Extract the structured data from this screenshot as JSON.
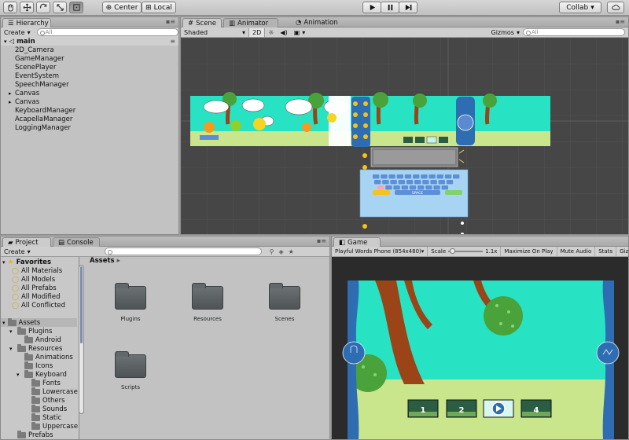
{
  "toolbar": {
    "tools": [
      "hand-icon",
      "move-icon",
      "rotate-icon",
      "scale-icon",
      "rect-icon"
    ],
    "pivot_center": "Center",
    "pivot_local": "Local",
    "collab_label": "Collab",
    "collab_arrow": "▾"
  },
  "hierarchy": {
    "tab_label": "Hierarchy",
    "create_label": "Create",
    "search_placeholder": "All",
    "scene_name": "main",
    "items": [
      {
        "label": "2D_Camera",
        "arrow": ""
      },
      {
        "label": "GameManager",
        "arrow": ""
      },
      {
        "label": "ScenePlayer",
        "arrow": ""
      },
      {
        "label": "EventSystem",
        "arrow": ""
      },
      {
        "label": "SpeechManager",
        "arrow": ""
      },
      {
        "label": "Canvas",
        "arrow": "▸"
      },
      {
        "label": "Canvas",
        "arrow": "▸"
      },
      {
        "label": "KeyboardManager",
        "arrow": ""
      },
      {
        "label": "AcapellaManager",
        "arrow": ""
      },
      {
        "label": "LoggingManager",
        "arrow": ""
      }
    ]
  },
  "scene": {
    "tabs": [
      "Scene",
      "Animator",
      "Animation"
    ],
    "shading": "Shaded",
    "mode_2d": "2D",
    "gizmos_label": "Gizmos",
    "search_placeholder": "All",
    "keyboard_space": "SPACE"
  },
  "project": {
    "tabs": [
      "Project",
      "Console"
    ],
    "create_label": "Create",
    "breadcrumb": "Assets",
    "favorites_label": "Favorites",
    "favorites": [
      "All Materials",
      "All Models",
      "All Prefabs",
      "All Modified",
      "All Conflicted"
    ],
    "assets_label": "Assets",
    "tree": [
      {
        "label": "Plugins",
        "depth": 1,
        "arrow": "▾"
      },
      {
        "label": "Android",
        "depth": 2,
        "arrow": ""
      },
      {
        "label": "Resources",
        "depth": 1,
        "arrow": "▾"
      },
      {
        "label": "Animations",
        "depth": 2,
        "arrow": ""
      },
      {
        "label": "Icons",
        "depth": 2,
        "arrow": ""
      },
      {
        "label": "Keyboard",
        "depth": 2,
        "arrow": "▾"
      },
      {
        "label": "Fonts",
        "depth": 3,
        "arrow": ""
      },
      {
        "label": "Lowercase",
        "depth": 3,
        "arrow": ""
      },
      {
        "label": "Others",
        "depth": 3,
        "arrow": ""
      },
      {
        "label": "Sounds",
        "depth": 3,
        "arrow": ""
      },
      {
        "label": "Static",
        "depth": 3,
        "arrow": ""
      },
      {
        "label": "Uppercase",
        "depth": 3,
        "arrow": ""
      },
      {
        "label": "Prefabs",
        "depth": 1,
        "arrow": ""
      }
    ],
    "folders": [
      "Plugins",
      "Resources",
      "Scenes",
      "Scripts"
    ]
  },
  "game": {
    "tab_label": "Game",
    "resolution": "Playful Words Phone (854x480)",
    "scale_label": "Scale",
    "scale_value": "1.1x",
    "maximize_label": "Maximize On Play",
    "mute_label": "Mute Audio",
    "stats_label": "Stats",
    "gizmos_label": "Gizmos",
    "filmstrip": [
      "1",
      "2",
      "",
      "4"
    ]
  },
  "colors": {
    "sky": "#27e3c4",
    "ground": "#c9e68d",
    "tree_trunk": "#9b4417",
    "leaves": "#4aa33a",
    "side_panel": "#2f6db3",
    "keyboard_bg": "#a8d4f4"
  }
}
